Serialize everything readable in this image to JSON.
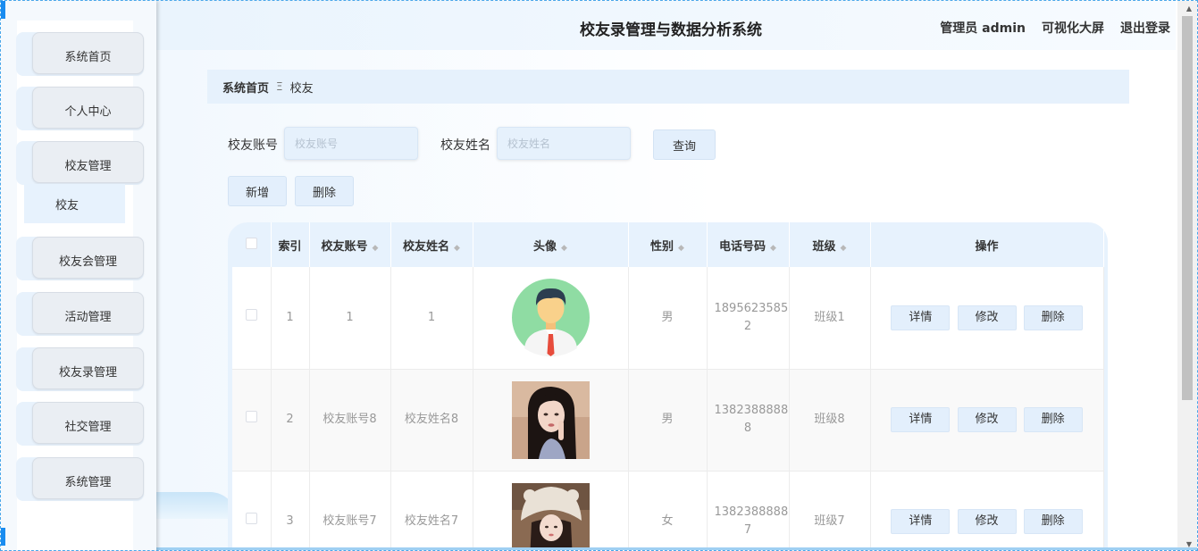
{
  "header": {
    "title": "校友录管理与数据分析系统",
    "admin_label": "管理员 admin",
    "dashboard_label": "可视化大屏",
    "logout_label": "退出登录"
  },
  "sidebar": {
    "items": [
      {
        "label": "系统首页"
      },
      {
        "label": "个人中心"
      },
      {
        "label": "校友管理"
      },
      {
        "label": "校友会管理"
      },
      {
        "label": "活动管理"
      },
      {
        "label": "校友录管理"
      },
      {
        "label": "社交管理"
      },
      {
        "label": "系统管理"
      }
    ],
    "submenu": {
      "label": "校友"
    }
  },
  "breadcrumb": {
    "home": "系统首页",
    "separator": "Ξ",
    "current": "校友"
  },
  "search": {
    "account_label": "校友账号",
    "account_placeholder": "校友账号",
    "name_label": "校友姓名",
    "name_placeholder": "校友姓名",
    "query_label": "查询"
  },
  "toolbar": {
    "add_label": "新增",
    "delete_label": "删除"
  },
  "table": {
    "columns": {
      "index": "索引",
      "account": "校友账号",
      "name": "校友姓名",
      "avatar": "头像",
      "gender": "性别",
      "phone": "电话号码",
      "class": "班级",
      "actions": "操作"
    },
    "actions": {
      "detail": "详情",
      "edit": "修改",
      "delete": "删除"
    },
    "rows": [
      {
        "index": "1",
        "account": "1",
        "name": "1",
        "gender": "男",
        "phone": "1895623585 2",
        "class": "班级1"
      },
      {
        "index": "2",
        "account": "校友账号8",
        "name": "校友姓名8",
        "gender": "男",
        "phone": "1382388888 8",
        "class": "班级8"
      },
      {
        "index": "3",
        "account": "校友账号7",
        "name": "校友姓名7",
        "gender": "女",
        "phone": "1382388888 7",
        "class": "班级7"
      }
    ]
  },
  "colors": {
    "accent": "#1a8cf0",
    "panel": "#e7f2fd"
  }
}
